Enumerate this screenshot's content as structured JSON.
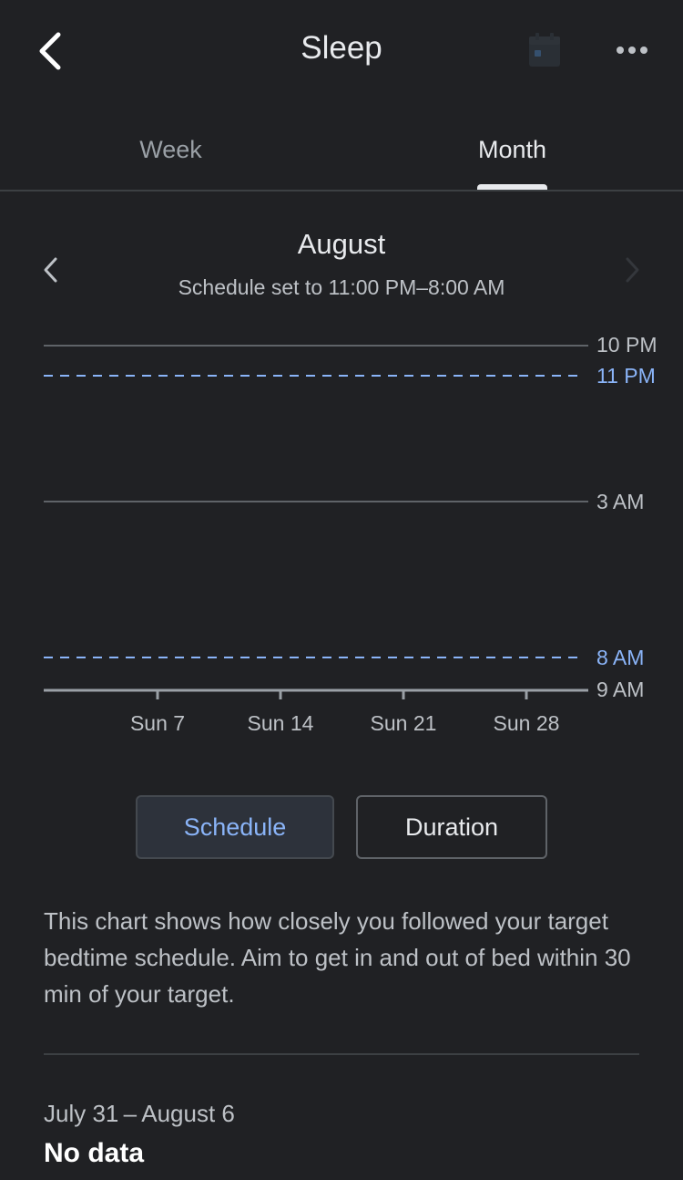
{
  "header": {
    "title": "Sleep",
    "back_icon": "chevron-left-icon",
    "calendar_icon": "calendar-icon",
    "more_icon": "more-horizontal-icon"
  },
  "tabs": [
    {
      "label": "Week",
      "selected": false
    },
    {
      "label": "Month",
      "selected": true
    }
  ],
  "period": {
    "title": "August",
    "subtitle": "Schedule set to 11:00 PM–8:00 AM",
    "prev_enabled": true,
    "next_enabled": false
  },
  "chart_data": {
    "type": "line",
    "y_axis": {
      "ticks": [
        "10 PM",
        "11 PM",
        "3 AM",
        "8 AM",
        "9 AM"
      ],
      "range": [
        "10 PM",
        "9 AM"
      ]
    },
    "x_axis": {
      "tick_labels": [
        "Sun 7",
        "Sun 14",
        "Sun 21",
        "Sun 28"
      ]
    },
    "reference_lines": [
      {
        "label": "11 PM",
        "style": "dashed",
        "color": "#8ab4f8"
      },
      {
        "label": "8 AM",
        "style": "dashed",
        "color": "#8ab4f8"
      }
    ],
    "series": [],
    "grid": true
  },
  "toggle": {
    "schedule_label": "Schedule",
    "duration_label": "Duration",
    "selected": "Schedule"
  },
  "description": "This chart shows how closely you followed your target bedtime schedule. Aim to get in and out of bed within 30 min of your target.",
  "summary": {
    "range": "July 31 – August 6",
    "value": "No data"
  },
  "colors": {
    "background": "#202124",
    "accent": "#8ab4f8",
    "text_primary": "#e8eaed",
    "text_secondary": "#bdc1c6"
  }
}
